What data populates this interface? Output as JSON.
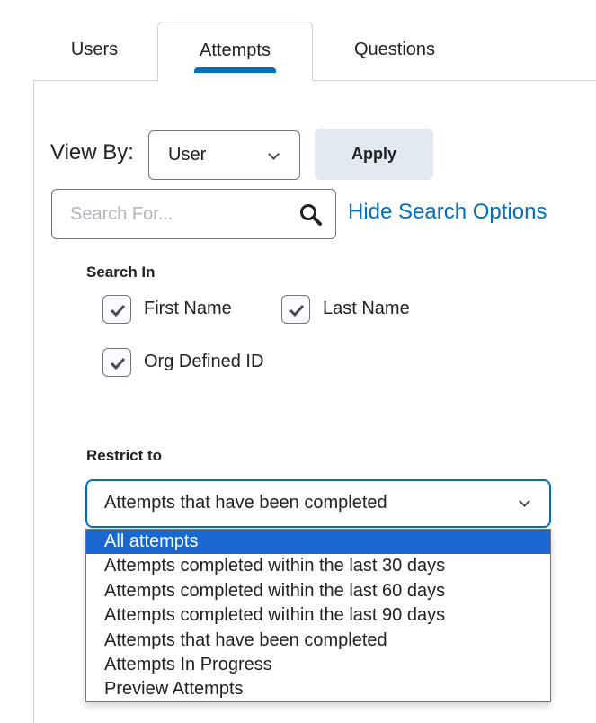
{
  "tabs": [
    {
      "label": "Users",
      "active": false
    },
    {
      "label": "Attempts",
      "active": true
    },
    {
      "label": "Questions",
      "active": false
    }
  ],
  "colors": {
    "accent": "#006fbf",
    "selected_option": "#1a67d2",
    "apply_bg": "#e3e9f1"
  },
  "view_by": {
    "label": "View By:",
    "value": "User",
    "icon": "chevron-down-icon"
  },
  "apply_button": {
    "label": "Apply"
  },
  "search": {
    "placeholder": "Search For...",
    "value": "",
    "icon": "search-icon"
  },
  "hide_search_options": {
    "label": "Hide Search Options"
  },
  "search_in": {
    "label": "Search In",
    "options": [
      {
        "label": "First Name",
        "checked": true
      },
      {
        "label": "Last Name",
        "checked": true
      },
      {
        "label": "Org Defined ID",
        "checked": true
      }
    ]
  },
  "restrict_to": {
    "label": "Restrict to",
    "value": "Attempts that have been completed",
    "options": [
      {
        "label": "All attempts",
        "highlighted": true
      },
      {
        "label": "Attempts completed within the last 30 days",
        "highlighted": false
      },
      {
        "label": "Attempts completed within the last 60 days",
        "highlighted": false
      },
      {
        "label": "Attempts completed within the last 90 days",
        "highlighted": false
      },
      {
        "label": "Attempts that have been completed",
        "highlighted": false
      },
      {
        "label": "Attempts In Progress",
        "highlighted": false
      },
      {
        "label": "Preview Attempts",
        "highlighted": false
      }
    ]
  }
}
